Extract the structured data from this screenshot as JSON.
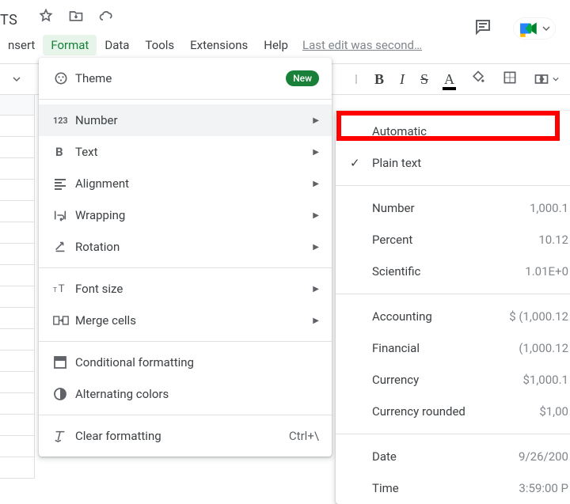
{
  "title_fragment": "TS",
  "menubar": {
    "insert": "nsert",
    "format": "Format",
    "data": "Data",
    "tools": "Tools",
    "extensions": "Extensions",
    "help": "Help",
    "last_edit": "Last edit was second…"
  },
  "format_menu": {
    "theme": "Theme",
    "new_badge": "New",
    "number": "Number",
    "text": "Text",
    "alignment": "Alignment",
    "wrapping": "Wrapping",
    "rotation": "Rotation",
    "font_size": "Font size",
    "merge_cells": "Merge cells",
    "conditional_formatting": "Conditional formatting",
    "alternating_colors": "Alternating colors",
    "clear_formatting": "Clear formatting",
    "clear_formatting_shortcut": "Ctrl+\\"
  },
  "number_menu": {
    "automatic": "Automatic",
    "plain_text": "Plain text",
    "number": {
      "label": "Number",
      "sample": "1,000.1"
    },
    "percent": {
      "label": "Percent",
      "sample": "10.12"
    },
    "scientific": {
      "label": "Scientific",
      "sample": "1.01E+0"
    },
    "accounting": {
      "label": "Accounting",
      "sample": "$ (1,000.12"
    },
    "financial": {
      "label": "Financial",
      "sample": "(1,000.12"
    },
    "currency": {
      "label": "Currency",
      "sample": "$1,000.1"
    },
    "currency_rounded": {
      "label": "Currency rounded",
      "sample": "$1,00"
    },
    "date": {
      "label": "Date",
      "sample": "9/26/200"
    },
    "time": {
      "label": "Time",
      "sample": "3:59:00 P"
    }
  },
  "toolbar": {
    "bold": "B",
    "italic": "I",
    "strike": "S",
    "textcolor": "A"
  }
}
